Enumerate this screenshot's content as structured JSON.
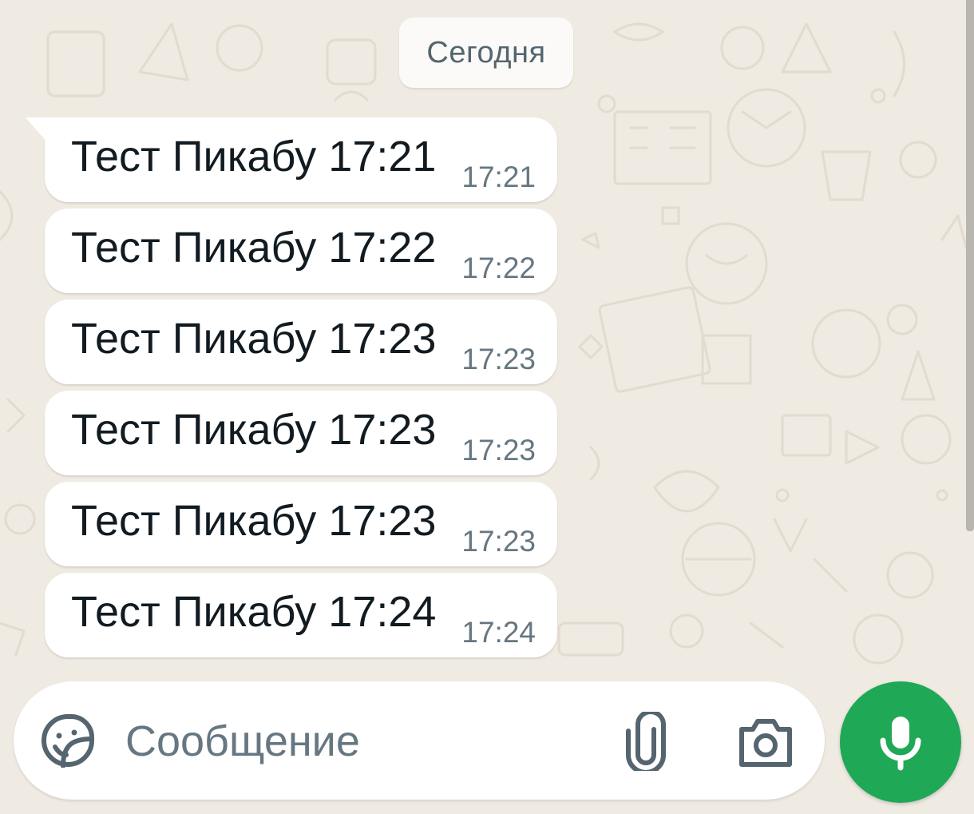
{
  "theme": {
    "wallpaper_color": "#efeae2",
    "bubble_color": "#ffffff",
    "accent_color": "#1fa855",
    "text_color": "#111b21",
    "meta_color": "#667781"
  },
  "date_divider": {
    "label": "Сегодня"
  },
  "messages": [
    {
      "text": "Тест Пикабу 17:21",
      "time": "17:21"
    },
    {
      "text": "Тест Пикабу 17:22",
      "time": "17:22"
    },
    {
      "text": "Тест Пикабу 17:23",
      "time": "17:23"
    },
    {
      "text": "Тест Пикабу 17:23",
      "time": "17:23"
    },
    {
      "text": "Тест Пикабу 17:23",
      "time": "17:23"
    },
    {
      "text": "Тест Пикабу 17:24",
      "time": "17:24"
    }
  ],
  "composer": {
    "placeholder": "Сообщение",
    "emoji_icon": "sticker-emoji-icon",
    "attach_icon": "paperclip-icon",
    "camera_icon": "camera-icon",
    "send_icon": "microphone-icon"
  }
}
